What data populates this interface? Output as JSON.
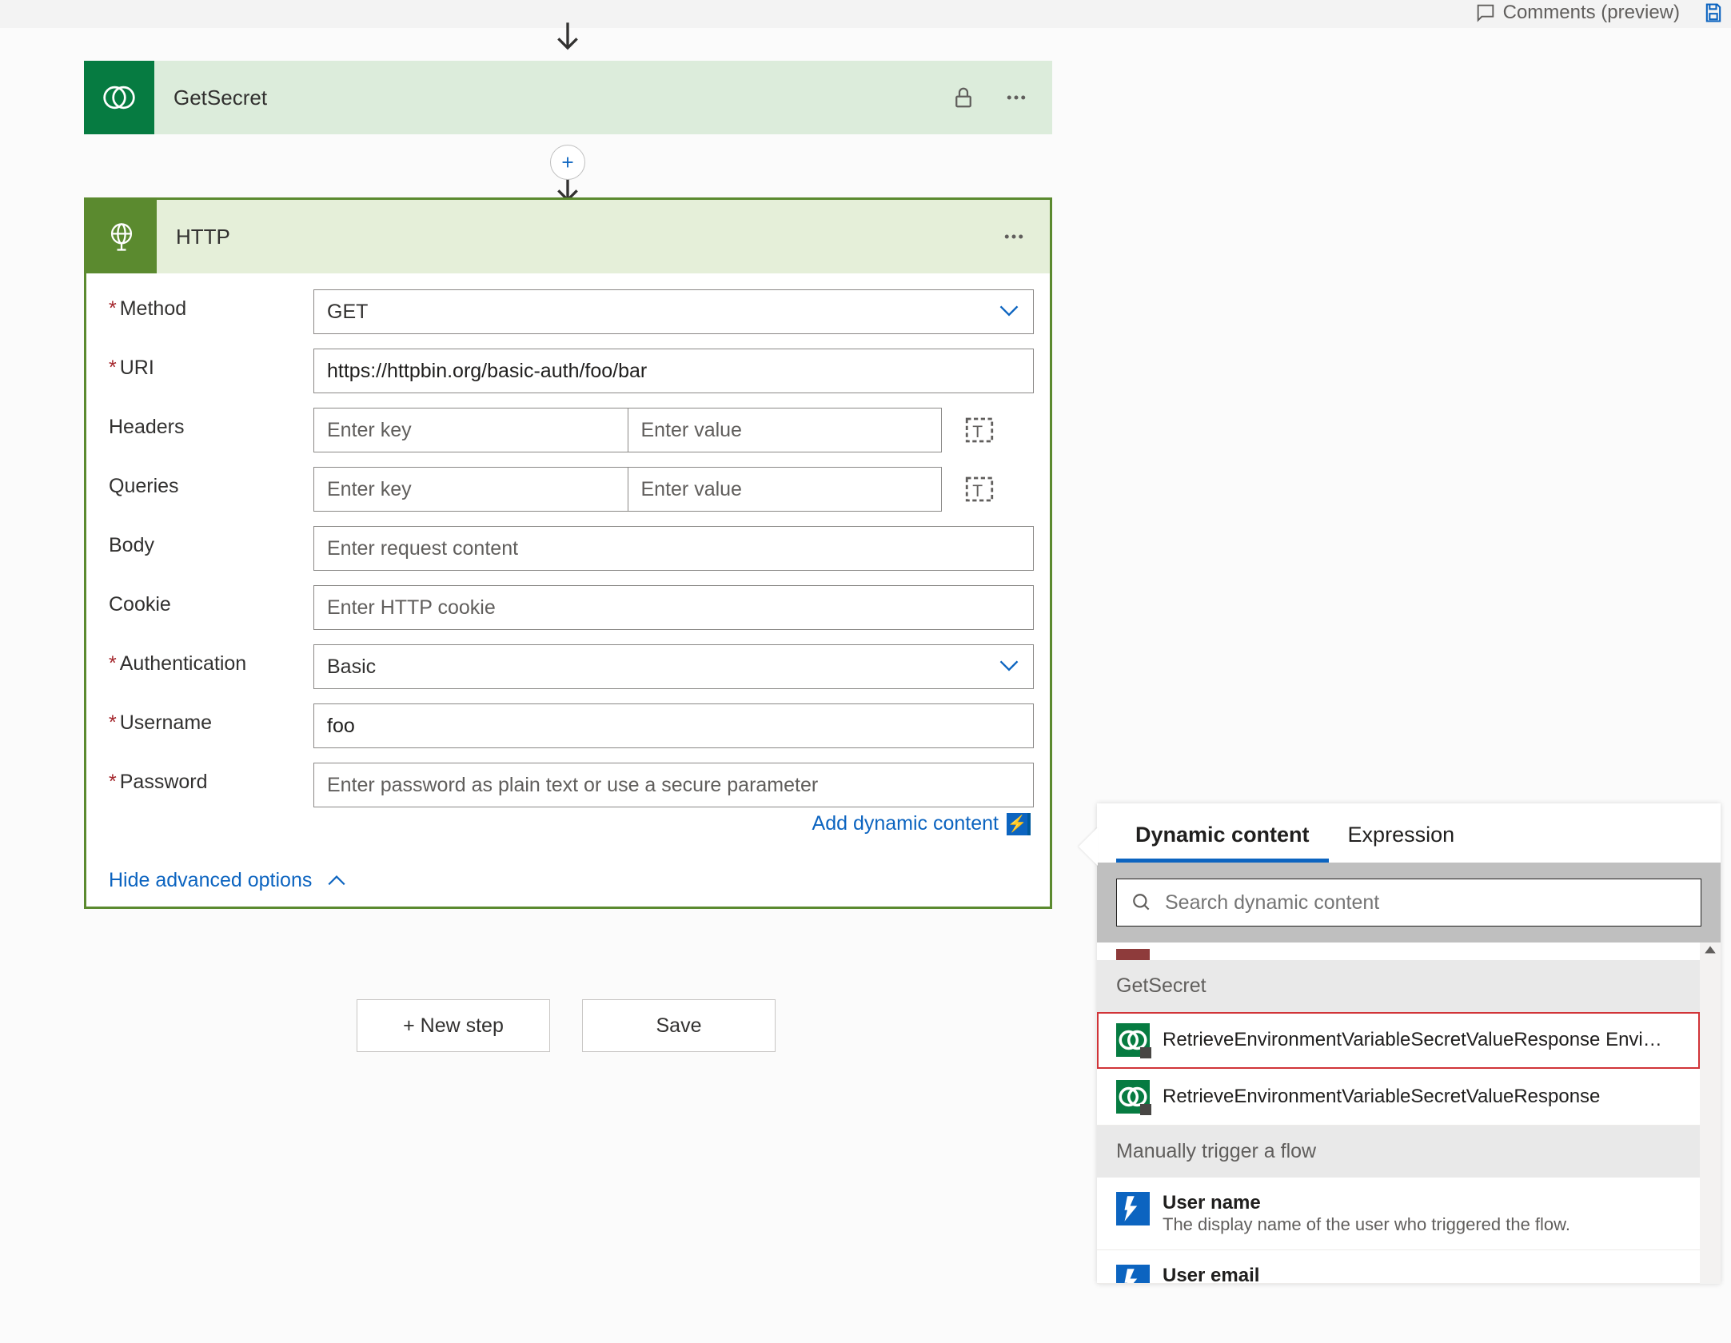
{
  "topbar": {
    "comments_label": "Comments (preview)"
  },
  "cards": {
    "getsecret": {
      "title": "GetSecret"
    },
    "http": {
      "title": "HTTP"
    }
  },
  "form": {
    "method_label": "Method",
    "method_value": "GET",
    "uri_label": "URI",
    "uri_value": "https://httpbin.org/basic-auth/foo/bar",
    "headers_label": "Headers",
    "headers_key_placeholder": "Enter key",
    "headers_value_placeholder": "Enter value",
    "queries_label": "Queries",
    "queries_key_placeholder": "Enter key",
    "queries_value_placeholder": "Enter value",
    "body_label": "Body",
    "body_placeholder": "Enter request content",
    "cookie_label": "Cookie",
    "cookie_placeholder": "Enter HTTP cookie",
    "auth_label": "Authentication",
    "auth_value": "Basic",
    "username_label": "Username",
    "username_value": "foo",
    "password_label": "Password",
    "password_placeholder": "Enter password as plain text or use a secure parameter",
    "add_dynamic_label": "Add dynamic content",
    "hide_advanced_label": "Hide advanced options"
  },
  "buttons": {
    "new_step": "+ New step",
    "save": "Save"
  },
  "dc": {
    "tab_dynamic": "Dynamic content",
    "tab_expression": "Expression",
    "search_placeholder": "Search dynamic content",
    "group1": "GetSecret",
    "item1": "RetrieveEnvironmentVariableSecretValueResponse Envi…",
    "item2": "RetrieveEnvironmentVariableSecretValueResponse",
    "group2": "Manually trigger a flow",
    "item3_title": "User name",
    "item3_sub": "The display name of the user who triggered the flow.",
    "item4_title": "User email"
  }
}
